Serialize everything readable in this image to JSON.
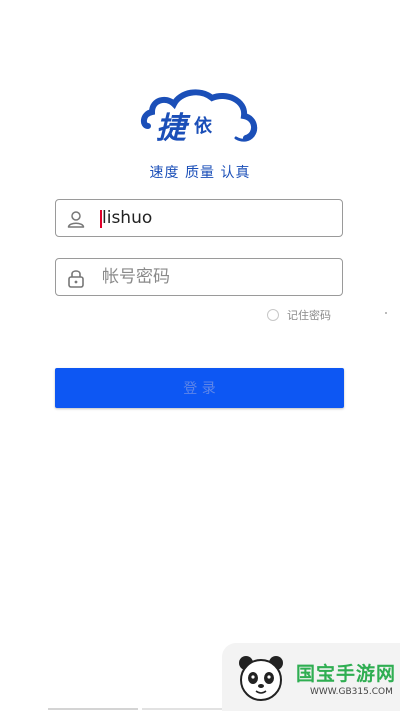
{
  "logo": {
    "char1": "捷",
    "char2": "依"
  },
  "slogan": "速度 质量 认真",
  "username": {
    "value": "lishuo",
    "placeholder": ""
  },
  "password": {
    "value": "",
    "placeholder": "帐号密码"
  },
  "remember": {
    "label": "记住密码",
    "checked": false
  },
  "login_button": {
    "label": "登 录"
  },
  "watermark": {
    "brand": "国宝手游网",
    "url": "WWW.GB315.COM"
  },
  "colors": {
    "brand_blue": "#1b4fb8",
    "button": "#0d57f3",
    "watermark_green": "#2fae52"
  },
  "icons": [
    "user-icon",
    "lock-icon",
    "panda-icon"
  ]
}
